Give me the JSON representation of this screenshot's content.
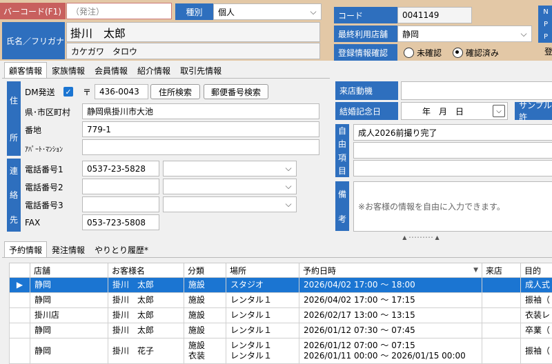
{
  "header": {
    "barcode_label": "バーコード(F1)",
    "barcode_placeholder": "（発注）",
    "type_label": "種別",
    "type_value": "個人",
    "name_label": "氏名／フリガナ",
    "name_value": "掛川　太郎",
    "furigana_value": "カケガワ　タロウ",
    "code_label": "コード",
    "code_value": "0041149",
    "last_store_label": "最終利用店舗",
    "last_store_value": "静岡",
    "reg_confirm_label": "登録情報確認",
    "reg_options": [
      "未確認",
      "確認済み"
    ],
    "reg_selected": 1,
    "edge_letters": [
      "N",
      "P",
      "P"
    ]
  },
  "tabs_top": [
    "顧客情報",
    "家族情報",
    "会員情報",
    "紹介情報",
    "取引先情報"
  ],
  "address": {
    "section_label": [
      "住",
      "所"
    ],
    "dm_label": "DM発送",
    "dm_checked": true,
    "postal_mark": "〒",
    "postal_value": "436-0043",
    "address_search_btn": "住所検索",
    "postal_search_btn": "郵便番号検索",
    "pref_city_label": "県･市区町村",
    "pref_city_value": "静岡県掛川市大池",
    "lot_label": "番地",
    "lot_value": "779-1",
    "apt_label": "ｱﾊﾟｰﾄ･ﾏﾝｼｮﾝ",
    "apt_value": ""
  },
  "contact": {
    "section_label": [
      "連",
      "絡",
      "先"
    ],
    "phone1_label": "電話番号1",
    "phone1_value": "0537-23-5828",
    "phone2_label": "電話番号2",
    "phone2_value": "",
    "phone3_label": "電話番号3",
    "phone3_value": "",
    "fax_label": "FAX",
    "fax_value": "053-723-5808"
  },
  "right_panel": {
    "visit_label": "来店動機",
    "visit_value": "",
    "anniv_label": "結婚記念日",
    "anniv_value": "年　月　日",
    "sample_btn": "サンプル許",
    "free_label": [
      "自",
      "由",
      "項",
      "目"
    ],
    "free_values": [
      "成人2026前撮り完了",
      "",
      ""
    ],
    "memo_label": [
      "備",
      "考"
    ],
    "memo_placeholder": "※お客様の情報を自由に入力できます。",
    "splitter_text": "▲ ･････････ ▲"
  },
  "tabs_bottom": [
    "予約情報",
    "発注情報",
    "やりとり履歴*"
  ],
  "table": {
    "columns": [
      "",
      "店舗",
      "お客様名",
      "分類",
      "場所",
      "予約日時",
      "来店",
      "目的"
    ],
    "rows": [
      {
        "indicator": "▶",
        "store": "静岡",
        "name": "掛川　太郎",
        "cat": "施設",
        "place": "スタジオ",
        "datetime": "2026/04/02 17:00 ～ 18:00",
        "visit": "",
        "purpose": "成人式"
      },
      {
        "indicator": "",
        "store": "静岡",
        "name": "掛川　太郎",
        "cat": "施設",
        "place": "レンタル１",
        "datetime": "2026/04/02 17:00 ～ 17:15",
        "visit": "",
        "purpose": "振袖（"
      },
      {
        "indicator": "",
        "store": "掛川店",
        "name": "掛川　太郎",
        "cat": "施設",
        "place": "レンタル１",
        "datetime": "2026/02/17 13:00 ～ 13:15",
        "visit": "",
        "purpose": "衣装レ"
      },
      {
        "indicator": "",
        "store": "静岡",
        "name": "掛川　太郎",
        "cat": "施設",
        "place": "レンタル１",
        "datetime": "2026/01/12 07:30 ～ 07:45",
        "visit": "",
        "purpose": "卒業（"
      },
      {
        "indicator": "",
        "store": "静岡",
        "name": "掛川　花子",
        "cat": "施設",
        "cat2": "衣装",
        "place": "レンタル１",
        "place2": "レンタル１",
        "datetime": "2026/01/12 07:00 ～ 07:15",
        "datetime2": "2026/01/11 00:00 ～ 2026/01/15 00:00",
        "visit": "",
        "purpose": "振袖（"
      }
    ]
  }
}
